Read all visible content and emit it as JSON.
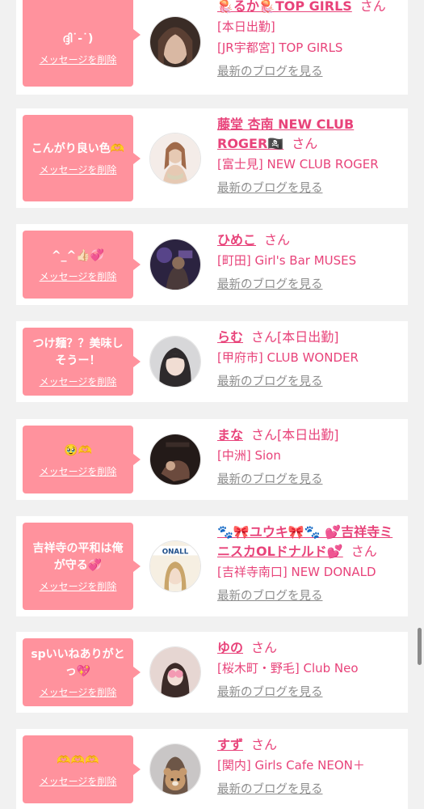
{
  "labels": {
    "delete": "メッセージを削除",
    "san": "さん",
    "blog": "最新のブログを見る"
  },
  "cards": [
    {
      "message": "ദ്ദി˙-˙)",
      "name": "🪼るか🪼TOP GIRLS",
      "status": "",
      "status_line": "[本日出勤]",
      "shop": "[JR宇都宮] TOP GIRLS",
      "avatar_colors": [
        "#3a2c26",
        "#d9b8a3"
      ]
    },
    {
      "message": "こんがり良い色🫶",
      "name": "藤堂 杏南 NEW CLUB ROGER🏴‍☠️",
      "status": "",
      "status_line": "",
      "shop": "[富士見] NEW CLUB ROGER",
      "avatar_colors": [
        "#f4ece8",
        "#e6c9b3"
      ]
    },
    {
      "message": "^_^👍🏻💞",
      "name": "ひめこ",
      "status": "",
      "status_line": "",
      "shop": "[町田] Girl's Bar MUSES",
      "avatar_colors": [
        "#2b2340",
        "#8a6d5a"
      ]
    },
    {
      "message": "つけ麺？？美味しそうー！",
      "name": "らむ",
      "status": "[本日出勤]",
      "status_line": "",
      "shop": "[甲府市] CLUB WONDER",
      "avatar_colors": [
        "#d7d7d9",
        "#2e2a2c"
      ]
    },
    {
      "message": "🥹🫶",
      "name": "まな",
      "status": "[本日出勤]",
      "status_line": "",
      "shop": "[中洲] Sion",
      "avatar_colors": [
        "#231a18",
        "#6b4a3d"
      ]
    },
    {
      "message": "吉祥寺の平和は俺が守る💞",
      "name": "🐾🎀ユウキ🎀🐾 💕吉祥寺ミニスカOLドナルド💕",
      "status": "",
      "status_line": "",
      "shop": "[吉祥寺南口] NEW DONALD",
      "avatar_colors": [
        "#f6efe2",
        "#c9a56a"
      ]
    },
    {
      "message": "spいいねありがとっ💖",
      "name": "ゆの",
      "status": "",
      "status_line": "",
      "shop": "[桜木町・野毛] Club Neo",
      "avatar_colors": [
        "#e6d6d2",
        "#3c2b28"
      ]
    },
    {
      "message": "🫶🫶🫶",
      "name": "すず",
      "status": "",
      "status_line": "",
      "shop": "[関内] Girls Cafe NEON＋",
      "avatar_colors": [
        "#c9c6c6",
        "#8a6b4f"
      ]
    }
  ]
}
